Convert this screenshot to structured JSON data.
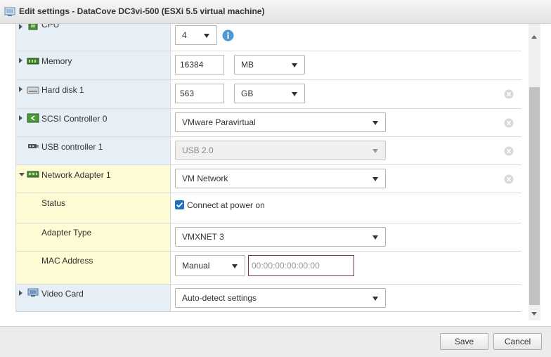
{
  "window": {
    "title": "Edit settings - DataCove DC3vi-500 (ESXi 5.5 virtual machine)"
  },
  "rows": {
    "cpu": {
      "label": "CPU",
      "value": "4",
      "icon": "cpu-icon"
    },
    "memory": {
      "label": "Memory",
      "value": "16384",
      "unit": "MB",
      "icon": "memory-icon"
    },
    "hard_disk": {
      "label": "Hard disk 1",
      "value": "563",
      "unit": "GB",
      "icon": "hard-disk-icon"
    },
    "scsi": {
      "label": "SCSI Controller 0",
      "value": "VMware Paravirtual",
      "icon": "scsi-controller-icon"
    },
    "usb": {
      "label": "USB controller 1",
      "value": "USB 2.0",
      "icon": "usb-icon"
    },
    "network": {
      "label": "Network Adapter 1",
      "value": "VM Network",
      "icon": "network-adapter-icon"
    },
    "status": {
      "label": "Status",
      "checkbox_label": "Connect at power on",
      "checked": true
    },
    "adapter_type": {
      "label": "Adapter Type",
      "value": "VMXNET 3"
    },
    "mac": {
      "label": "MAC Address",
      "mode": "Manual",
      "placeholder": "00:00:00:00:00:00"
    },
    "video": {
      "label": "Video Card",
      "value": "Auto-detect settings",
      "icon": "video-card-icon"
    }
  },
  "footer": {
    "save_label": "Save",
    "cancel_label": "Cancel"
  },
  "colors": {
    "accent": "#1d6fc2",
    "label_bg": "#e6eef6",
    "highlight_bg": "#fdfbd3"
  }
}
